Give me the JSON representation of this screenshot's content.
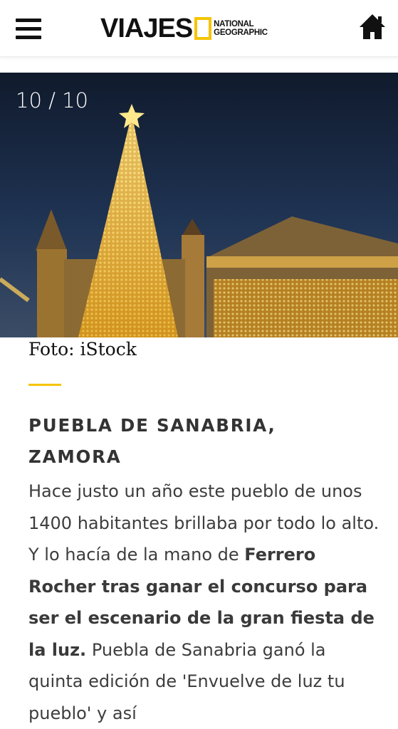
{
  "header": {
    "logo_word": "VIAJES",
    "logo_ng_line1": "NATIONAL",
    "logo_ng_line2": "GEOGRAPHIC",
    "menu_icon": "hamburger-menu-icon",
    "home_icon": "home-icon"
  },
  "gallery": {
    "counter": "10 / 10",
    "caption": "Foto: iStock"
  },
  "article": {
    "title_line1": "PUEBLA DE SANABRIA,",
    "title_line2": "ZAMORA",
    "p1": "Hace justo un año este pueblo de unos 1400 habitantes brillaba por todo lo alto. Y lo hacía de la mano de ",
    "p1_bold": "Ferrero Rocher tras ganar el concurso para ser el escenario de la gran fiesta de la luz.",
    "p1_rest": " Puebla de Sanabria ganó la quinta edición de 'Envuelve de luz tu pueblo' y así"
  },
  "colors": {
    "accent": "#f5c400",
    "text": "#3d3d3d",
    "sky": "#1a2538"
  }
}
